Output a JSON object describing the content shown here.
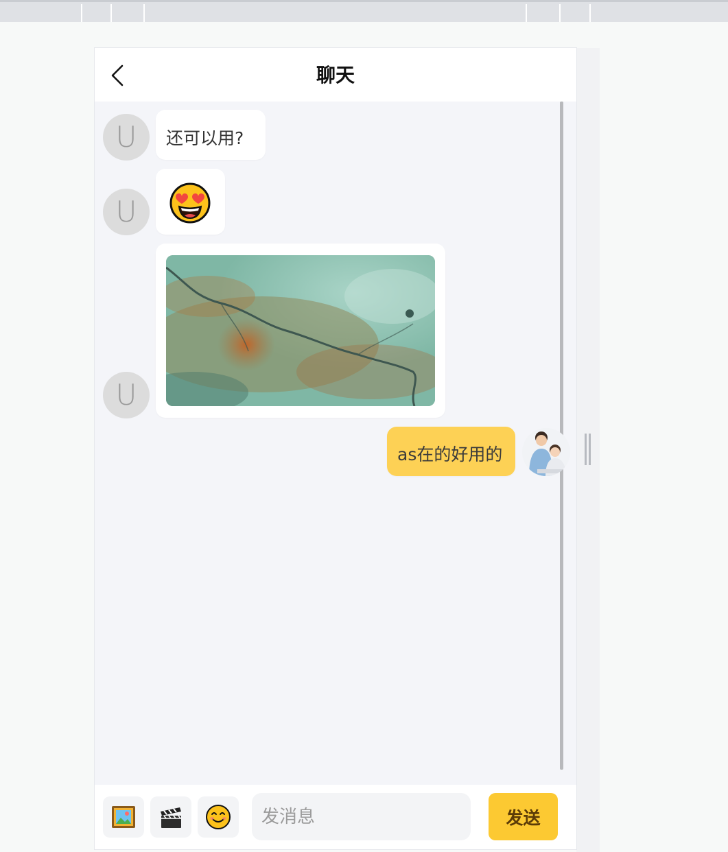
{
  "header": {
    "title": "聊天",
    "back_icon": "chevron-left-icon"
  },
  "messages": [
    {
      "from": "other",
      "avatar_letter": "U",
      "type": "text",
      "text": "还可以用?"
    },
    {
      "from": "other",
      "avatar_letter": "U",
      "type": "emoji",
      "emoji": "heart-eyes-face"
    },
    {
      "from": "other",
      "avatar_letter": "U",
      "type": "image",
      "image": "aerial-landscape-photo"
    },
    {
      "from": "me",
      "type": "text",
      "text": "as在的好用的",
      "avatar": "user-photo-avatar"
    }
  ],
  "composer": {
    "tools": [
      {
        "name": "image-tool",
        "icon": "framed-picture-icon"
      },
      {
        "name": "video-tool",
        "icon": "clapper-board-icon"
      },
      {
        "name": "emoji-tool",
        "icon": "smiling-face-icon"
      }
    ],
    "placeholder": "发消息",
    "send_label": "发送"
  },
  "colors": {
    "my_bubble": "#fdd155",
    "send_button": "#fcc932",
    "background": "#f4f5f9"
  }
}
